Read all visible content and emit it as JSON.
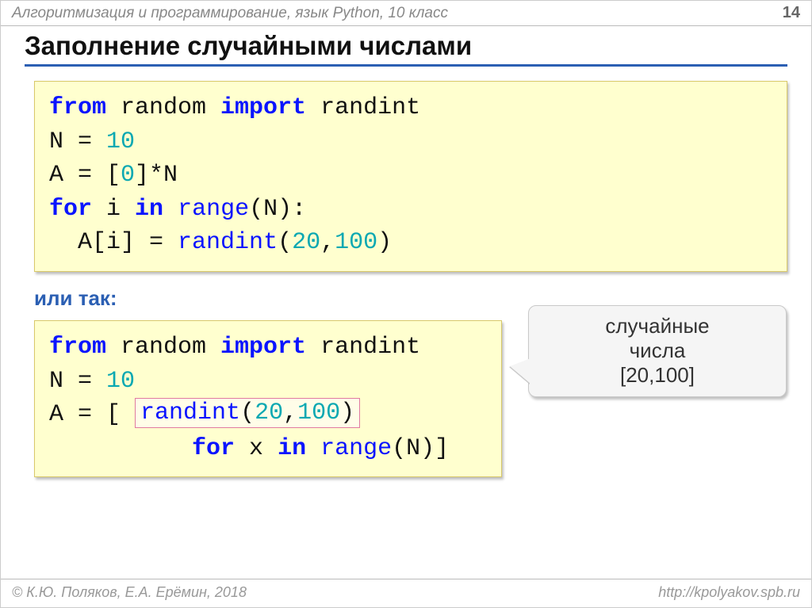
{
  "header": {
    "breadcrumb": "Алгоритмизация и программирование, язык Python, 10 класс",
    "page_number": "14"
  },
  "title": "Заполнение случайными числами",
  "code1": {
    "l1_from": "from",
    "l1_mod": " random ",
    "l1_import": "import",
    "l1_name": " randint",
    "l2_a": "N",
    "l2_eq": " = ",
    "l2_n": "10",
    "l3_a": "A",
    "l3_eq": " = [",
    "l3_zero": "0",
    "l3_tail": "]*N",
    "l4_for": "for",
    "l4_mid": " i ",
    "l4_in": "in",
    "l4_sp": " ",
    "l4_range": "range",
    "l4_paren": "(N):",
    "l5_pre": "  A[i]",
    "l5_eq": " = ",
    "l5_fn": "randint",
    "l5_open": "(",
    "l5_a": "20",
    "l5_c": ",",
    "l5_b": "100",
    "l5_close": ")"
  },
  "or_label": "или так:",
  "code2": {
    "l1_from": "from",
    "l1_mod": " random ",
    "l1_import": "import",
    "l1_name": " randint",
    "l2_a": "N",
    "l2_eq": " = ",
    "l2_n": "10",
    "l3_a": "A",
    "l3_eq": " = [ ",
    "l3_fn": "randint",
    "l3_open": "(",
    "l3_x": "20",
    "l3_c": ",",
    "l3_y": "100",
    "l3_close": ")",
    "l4_pad": "          ",
    "l4_for": "for",
    "l4_mid": " x ",
    "l4_in": "in",
    "l4_sp": " ",
    "l4_range": "range",
    "l4_tail": "(N)]"
  },
  "callout": {
    "line1": "случайные",
    "line2": "числа",
    "line3": "[20,100]"
  },
  "footer": {
    "left": "© К.Ю. Поляков, Е.А. Ерёмин, 2018",
    "right": "http://kpolyakov.spb.ru"
  }
}
